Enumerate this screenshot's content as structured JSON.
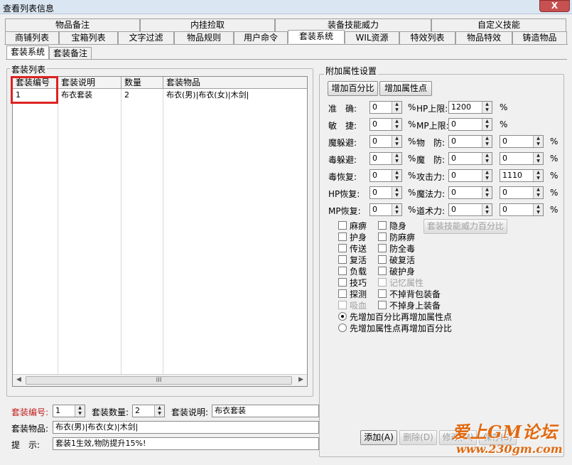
{
  "window": {
    "title": "查看列表信息",
    "close": "X"
  },
  "tabs_row1": [
    "物品备注",
    "内挂捡取",
    "装备技能威力",
    "自定义技能"
  ],
  "tabs_row2": [
    "商铺列表",
    "宝箱列表",
    "文字过滤",
    "物品规则",
    "用户命令",
    "套装系统",
    "WIL资源",
    "特效列表",
    "物品特效",
    "铸造物品"
  ],
  "subtabs": [
    "套装系统",
    "套装备注"
  ],
  "set_list": {
    "title": "套装列表",
    "columns": [
      "套装编号",
      "套装说明",
      "数量",
      "套装物品"
    ],
    "rows": [
      [
        "1",
        "布衣套装",
        "2",
        "布衣(男)|布衣(女)|木剑|"
      ]
    ],
    "scroll_thumb": "III"
  },
  "attr": {
    "title": "附加属性设置",
    "mode_buttons": [
      "增加百分比",
      "增加属性点"
    ],
    "rows": [
      {
        "label": "准　确:",
        "val": "0",
        "pct": "%",
        "label2": "HP上限:",
        "v2": "1200",
        "pct2": "%"
      },
      {
        "label": "敏　捷:",
        "val": "0",
        "pct": "%",
        "label2": "MP上限:",
        "v2": "0",
        "pct2": "%"
      },
      {
        "label": "魔躲避:",
        "val": "0",
        "pct": "%",
        "label2": "物　防:",
        "v2": "0",
        "v3": "0",
        "pct2": "%"
      },
      {
        "label": "毒躲避:",
        "val": "0",
        "pct": "%",
        "label2": "魔　防:",
        "v2": "0",
        "v3": "0",
        "pct2": "%"
      },
      {
        "label": "毒恢复:",
        "val": "0",
        "pct": "%",
        "label2": "攻击力:",
        "v2": "0",
        "v3": "1110",
        "pct2": "%"
      },
      {
        "label": "HP恢复:",
        "val": "0",
        "pct": "%",
        "label2": "魔法力:",
        "v2": "0",
        "v3": "0",
        "pct2": "%"
      },
      {
        "label": "MP恢复:",
        "val": "0",
        "pct": "%",
        "label2": "道术力:",
        "v2": "0",
        "v3": "0",
        "pct2": "%"
      }
    ],
    "skill_btn": "套装技能威力百分比",
    "checks_left": [
      "麻痹",
      "护身",
      "传送",
      "复活",
      "负载",
      "技巧",
      "探测",
      "吸血"
    ],
    "checks_right": [
      "隐身",
      "防麻痹",
      "防全毒",
      "破复活",
      "破护身",
      "记忆属性",
      "不掉背包装备",
      "不掉身上装备"
    ],
    "radios": [
      "先增加百分比再增加属性点",
      "先增加属性点再增加百分比"
    ]
  },
  "form": {
    "id_label": "套装编号:",
    "id_value": "1",
    "count_label": "套装数量:",
    "count_value": "2",
    "desc_label": "套装说明:",
    "desc_value": "布衣套装",
    "items_label": "套装物品:",
    "items_value": "布衣(男)|布衣(女)|木剑|",
    "tip_label": "提　示:",
    "tip_value": "套装1生效,物防提升15%!"
  },
  "buttons": {
    "add": "添加(A)",
    "delete": "删除(D)",
    "modify": "修改(M)",
    "save": "保存(S)"
  },
  "watermark": {
    "line1": "爱上GM论坛",
    "line2": "www.230gm.com"
  }
}
